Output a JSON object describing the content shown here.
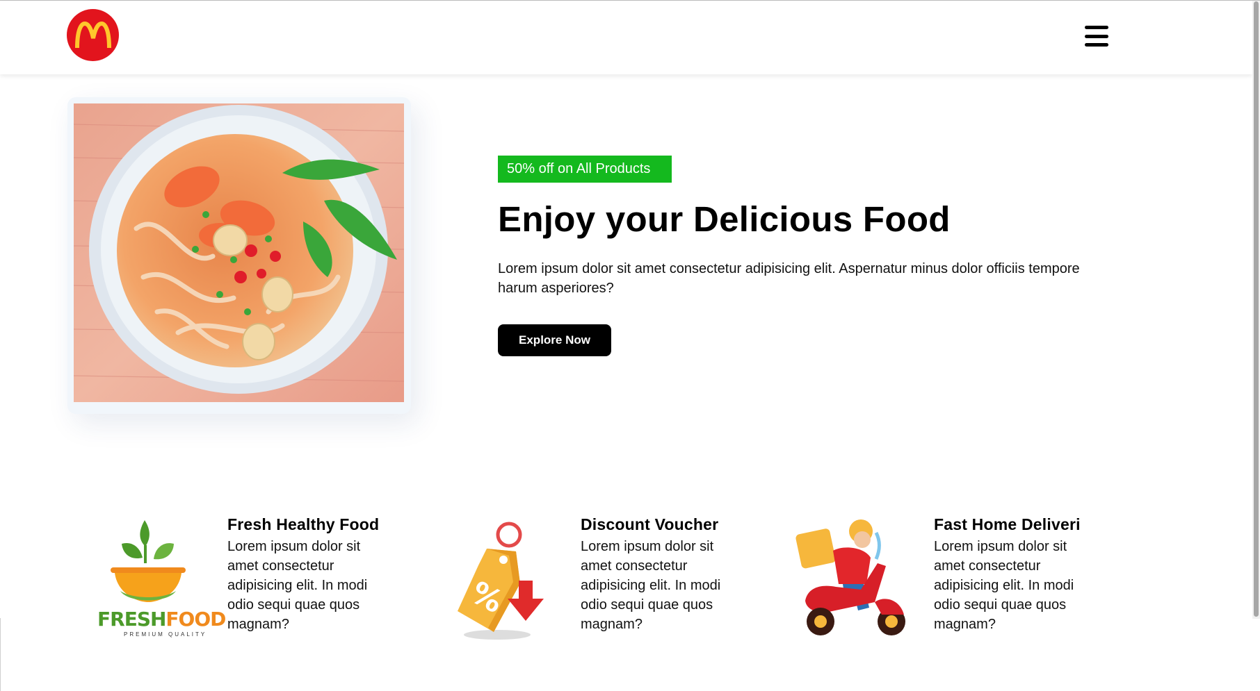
{
  "brand": {
    "logo_name": "mcdonalds-logo",
    "logo_bg": "#e2141d",
    "logo_fg": "#ffc72c"
  },
  "nav": {
    "menu_icon": "hamburger-menu-icon"
  },
  "hero": {
    "badge": "50% off on All Products",
    "badge_color": "#14b91e",
    "title": "Enjoy your Delicious Food",
    "description": "Lorem ipsum dolor sit amet consectetur adipisicing elit. Aspernatur minus dolor officiis tempore harum asperiores?",
    "button_label": "Explore Now",
    "image": "noodle-soup-bowl-photo"
  },
  "features": [
    {
      "icon": "fresh-food-logo-icon",
      "title": "Fresh Healthy Food",
      "text": "Lorem ipsum dolor sit\namet consectetur\nadipisicing elit. In modi\nodio sequi quae quos\n magnam?",
      "logo_text": "FRESHFOOD",
      "logo_subtext": "PREMIUM QUALITY"
    },
    {
      "icon": "discount-tag-icon",
      "title": "Discount Voucher",
      "text": "Lorem ipsum dolor sit\namet consectetur\nadipisicing elit. In modi\nodio sequi quae quos\n magnam?"
    },
    {
      "icon": "delivery-scooter-icon",
      "title": "Fast Home Deliveri",
      "text": "Lorem ipsum dolor sit\namet consectetur\nadipisicing elit. In modi\nodio sequi quae quos\n magnam?"
    }
  ]
}
